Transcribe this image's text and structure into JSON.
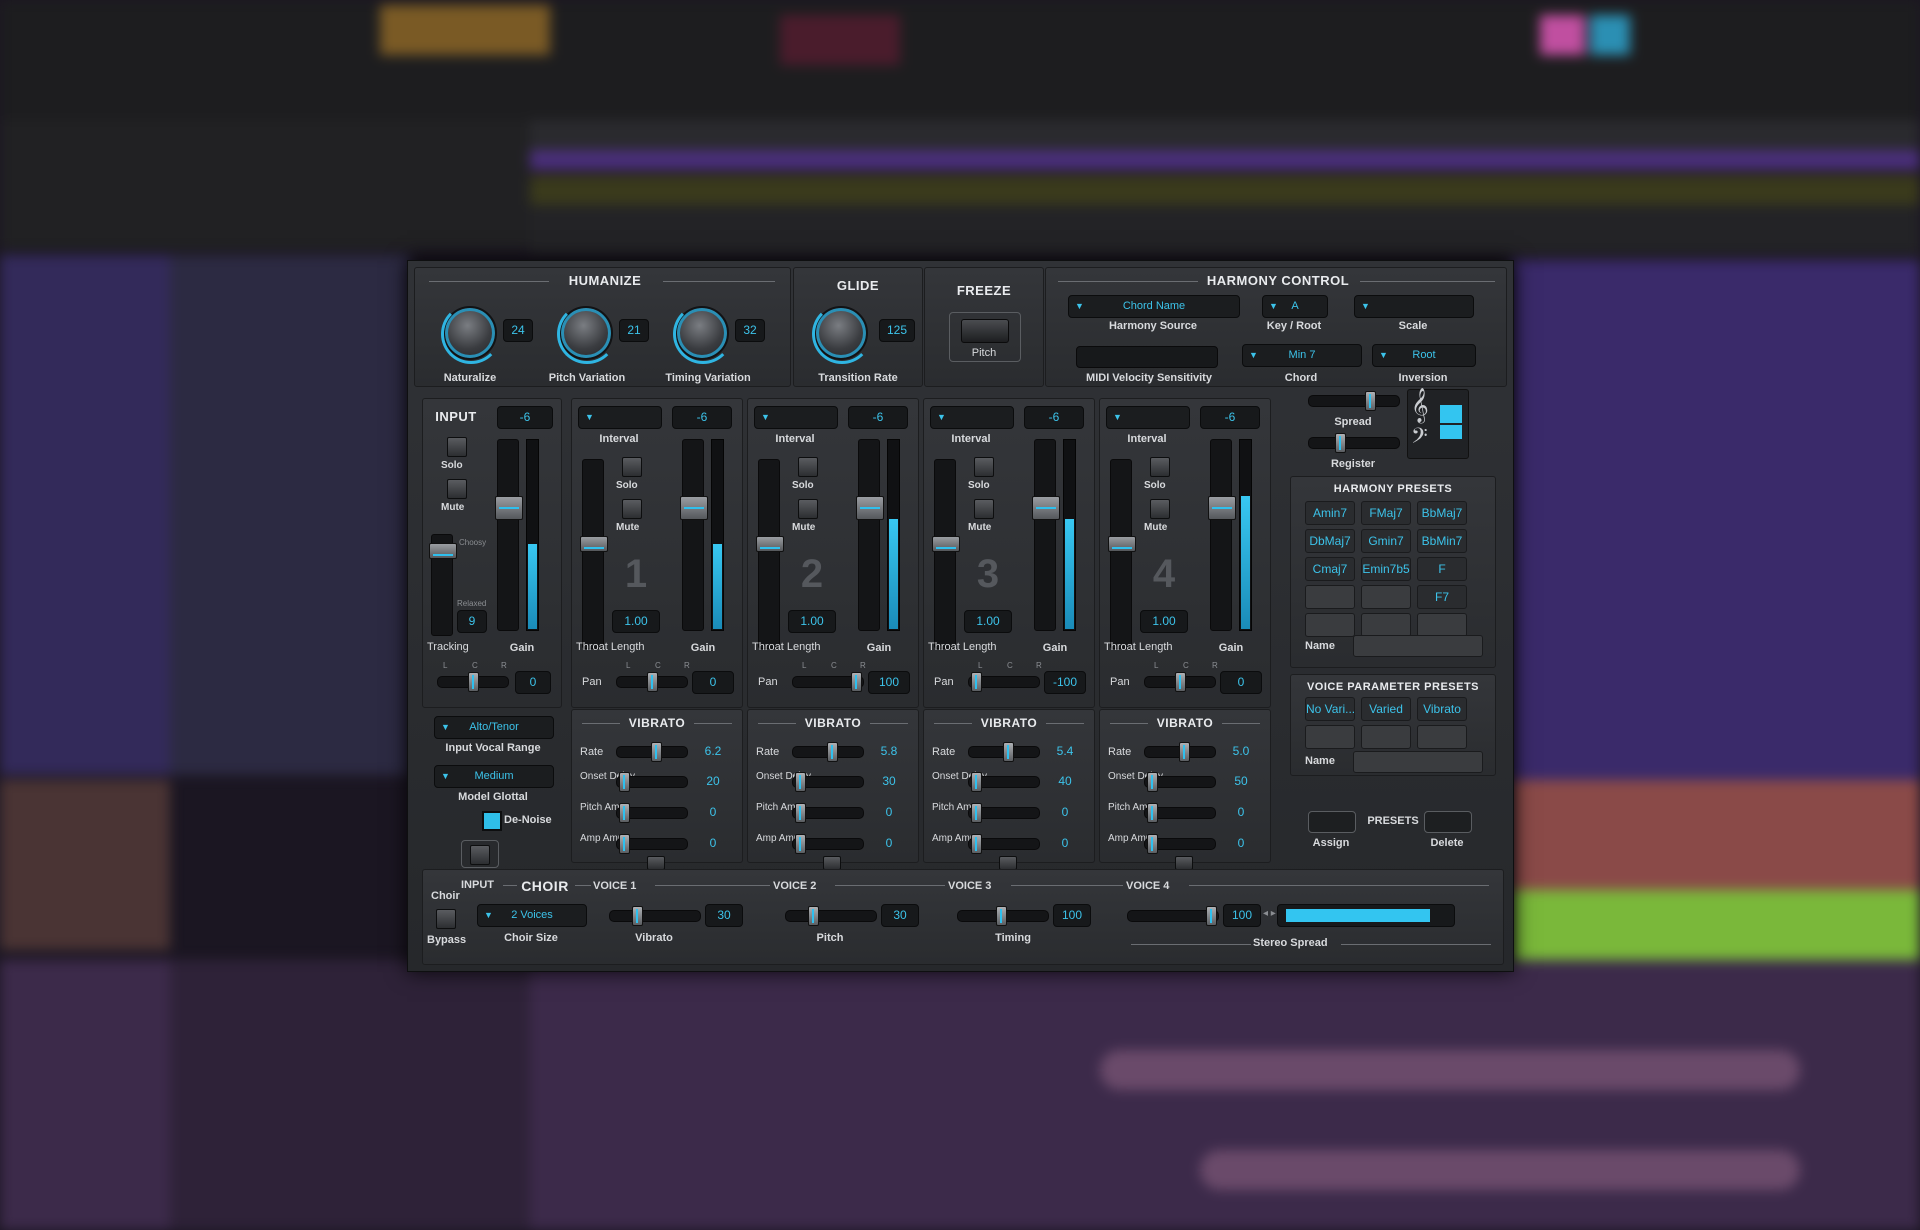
{
  "humanize": {
    "title": "HUMANIZE",
    "knobs": [
      {
        "label": "Naturalize",
        "value": "24"
      },
      {
        "label": "Pitch Variation",
        "value": "21"
      },
      {
        "label": "Timing Variation",
        "value": "32"
      }
    ]
  },
  "glide": {
    "title": "GLIDE",
    "label": "Transition Rate",
    "value": "125"
  },
  "freeze": {
    "title": "FREEZE",
    "label": "Pitch"
  },
  "harmony_control": {
    "title": "HARMONY CONTROL",
    "harmony_source": {
      "value": "Chord Name",
      "label": "Harmony Source"
    },
    "key_root": {
      "value": "A",
      "label": "Key / Root"
    },
    "scale": {
      "value": "",
      "label": "Scale"
    },
    "midi_velocity": {
      "label": "MIDI Velocity Sensitivity"
    },
    "chord": {
      "value": "Min 7",
      "label": "Chord"
    },
    "inversion": {
      "value": "Root",
      "label": "Inversion"
    },
    "spread_label": "Spread",
    "register_label": "Register",
    "treble_clef": "𝄞",
    "bass_clef": "𝄢"
  },
  "input": {
    "title": "INPUT",
    "gain_value": "-6",
    "solo_label": "Solo",
    "mute_label": "Mute",
    "choosy_label": "Choosy",
    "relaxed_label": "Relaxed",
    "tracking_value": "9",
    "tracking_label": "Tracking",
    "gain_label": "Gain",
    "pan_value": "0",
    "gain_level": 0.45,
    "lcr": [
      "L",
      "C",
      "R"
    ],
    "vocal_range": {
      "value": "Alto/Tenor",
      "label": "Input Vocal Range"
    },
    "model_glottal": {
      "value": "Medium",
      "label": "Model Glottal"
    },
    "denoise_label": "De-Noise"
  },
  "voices": [
    {
      "number": "1",
      "interval": "",
      "gain": "-6",
      "throat": "1.00",
      "pan": "0",
      "rate": "6.2",
      "onset": "20",
      "pitch_amnt": "0",
      "amp_amnt": "0",
      "gain_level": 0.45
    },
    {
      "number": "2",
      "interval": "",
      "gain": "-6",
      "throat": "1.00",
      "pan": "100",
      "rate": "5.8",
      "onset": "30",
      "pitch_amnt": "0",
      "amp_amnt": "0",
      "gain_level": 0.58
    },
    {
      "number": "3",
      "interval": "",
      "gain": "-6",
      "throat": "1.00",
      "pan": "-100",
      "rate": "5.4",
      "onset": "40",
      "pitch_amnt": "0",
      "amp_amnt": "0",
      "gain_level": 0.58
    },
    {
      "number": "4",
      "interval": "",
      "gain": "-6",
      "throat": "1.00",
      "pan": "0",
      "rate": "5.0",
      "onset": "50",
      "pitch_amnt": "0",
      "amp_amnt": "0",
      "gain_level": 0.7
    }
  ],
  "voice_labels": {
    "interval": "Interval",
    "solo": "Solo",
    "mute": "Mute",
    "throat": "Throat Length",
    "gain": "Gain",
    "pan": "Pan",
    "vibrato": "VIBRATO",
    "rate": "Rate",
    "onset": "Onset Delay",
    "pitch_amnt": "Pitch Amnt",
    "amp_amnt": "Amp Amnt"
  },
  "harmony_presets": {
    "title": "HARMONY PRESETS",
    "items": [
      "Amin7",
      "FMaj7",
      "BbMaj7",
      "DbMaj7",
      "Gmin7",
      "BbMin7",
      "Cmaj7",
      "Emin7b5",
      "F",
      "",
      "",
      "F7",
      "",
      "",
      ""
    ],
    "name_label": "Name"
  },
  "voice_parameter_presets": {
    "title": "VOICE PARAMETER PRESETS",
    "items": [
      "No Vari...",
      "Varied",
      "Vibrato",
      "",
      "",
      ""
    ],
    "name_label": "Name"
  },
  "presets_bar": {
    "label": "PRESETS",
    "assign": "Assign",
    "delete": "Delete"
  },
  "choir": {
    "choir_label": "Choir",
    "bypass_label": "Bypass",
    "input_label": "INPUT",
    "title": "CHOIR",
    "voice_headers": [
      "VOICE 1",
      "VOICE 2",
      "VOICE 3",
      "VOICE 4"
    ],
    "choir_size": {
      "value": "2 Voices",
      "label": "Choir Size"
    },
    "vibrato": {
      "value": "30",
      "label": "Vibrato"
    },
    "pitch": {
      "value": "30",
      "label": "Pitch"
    },
    "timing": {
      "value": "100",
      "label": "Timing"
    },
    "stereo_spread": {
      "value": "100",
      "label": "Stereo Spread"
    }
  },
  "colors": {
    "accent": "#3cc3ea",
    "panel": "#2c2e31"
  }
}
